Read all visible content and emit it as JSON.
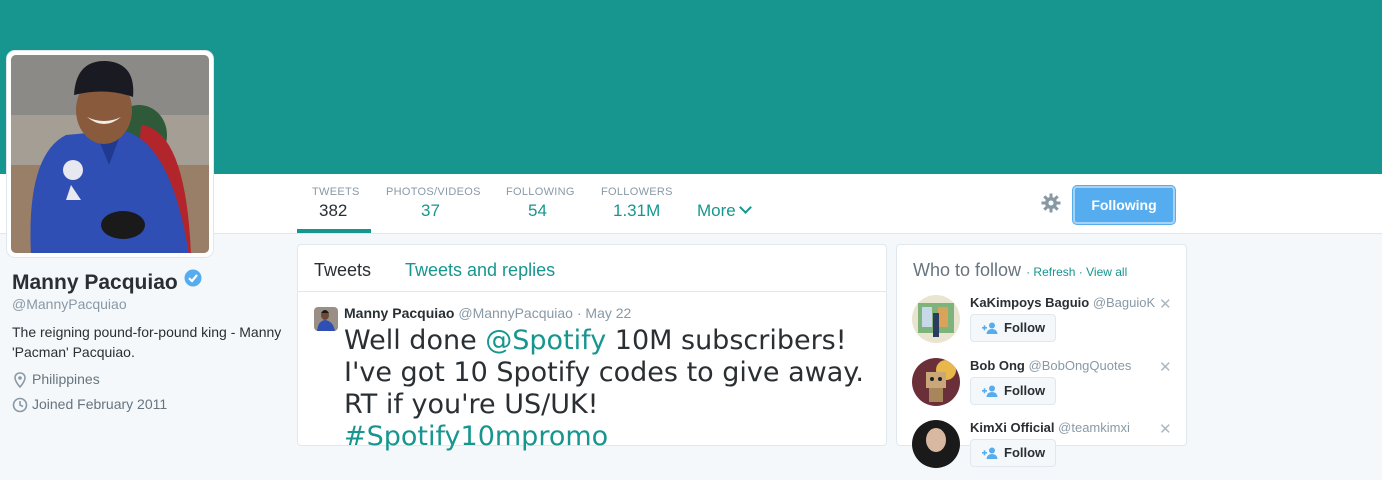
{
  "profile": {
    "name": "Manny Pacquiao",
    "handle": "@MannyPacquiao",
    "bio": "The reigning pound-for-pound king - Manny 'Pacman' Pacquiao.",
    "location": "Philippines",
    "joined": "Joined February 2011",
    "header_color": "#17968f"
  },
  "stats": [
    {
      "label": "TWEETS",
      "value": "382"
    },
    {
      "label": "PHOTOS/VIDEOS",
      "value": "37"
    },
    {
      "label": "FOLLOWING",
      "value": "54"
    },
    {
      "label": "FOLLOWERS",
      "value": "1.31M"
    }
  ],
  "nav": {
    "more_label": "More",
    "following_button": "Following",
    "settings_icon": "gear-icon"
  },
  "timeline": {
    "tabs": [
      "Tweets",
      "Tweets and replies"
    ],
    "tweet": {
      "author": "Manny Pacquiao",
      "handle": "@MannyPacquiao",
      "date": "· May 22",
      "text_1": "Well done ",
      "mention": "@Spotify",
      "text_2": " 10M subscribers! I've got 10 Spotify codes to give away. RT if you're US/UK! ",
      "hashtag": "#Spotify10mpromo"
    }
  },
  "who_to_follow": {
    "title": "Who to follow",
    "refresh": "Refresh",
    "view_all": "View all",
    "users": [
      {
        "name": "KaKimpoys Baguio",
        "handle": "@BaguioK",
        "button": "Follow"
      },
      {
        "name": "Bob Ong",
        "handle": "@BobOngQuotes",
        "button": "Follow"
      },
      {
        "name": "KimXi Official",
        "handle": "@teamkimxi",
        "button": "Follow"
      }
    ]
  }
}
